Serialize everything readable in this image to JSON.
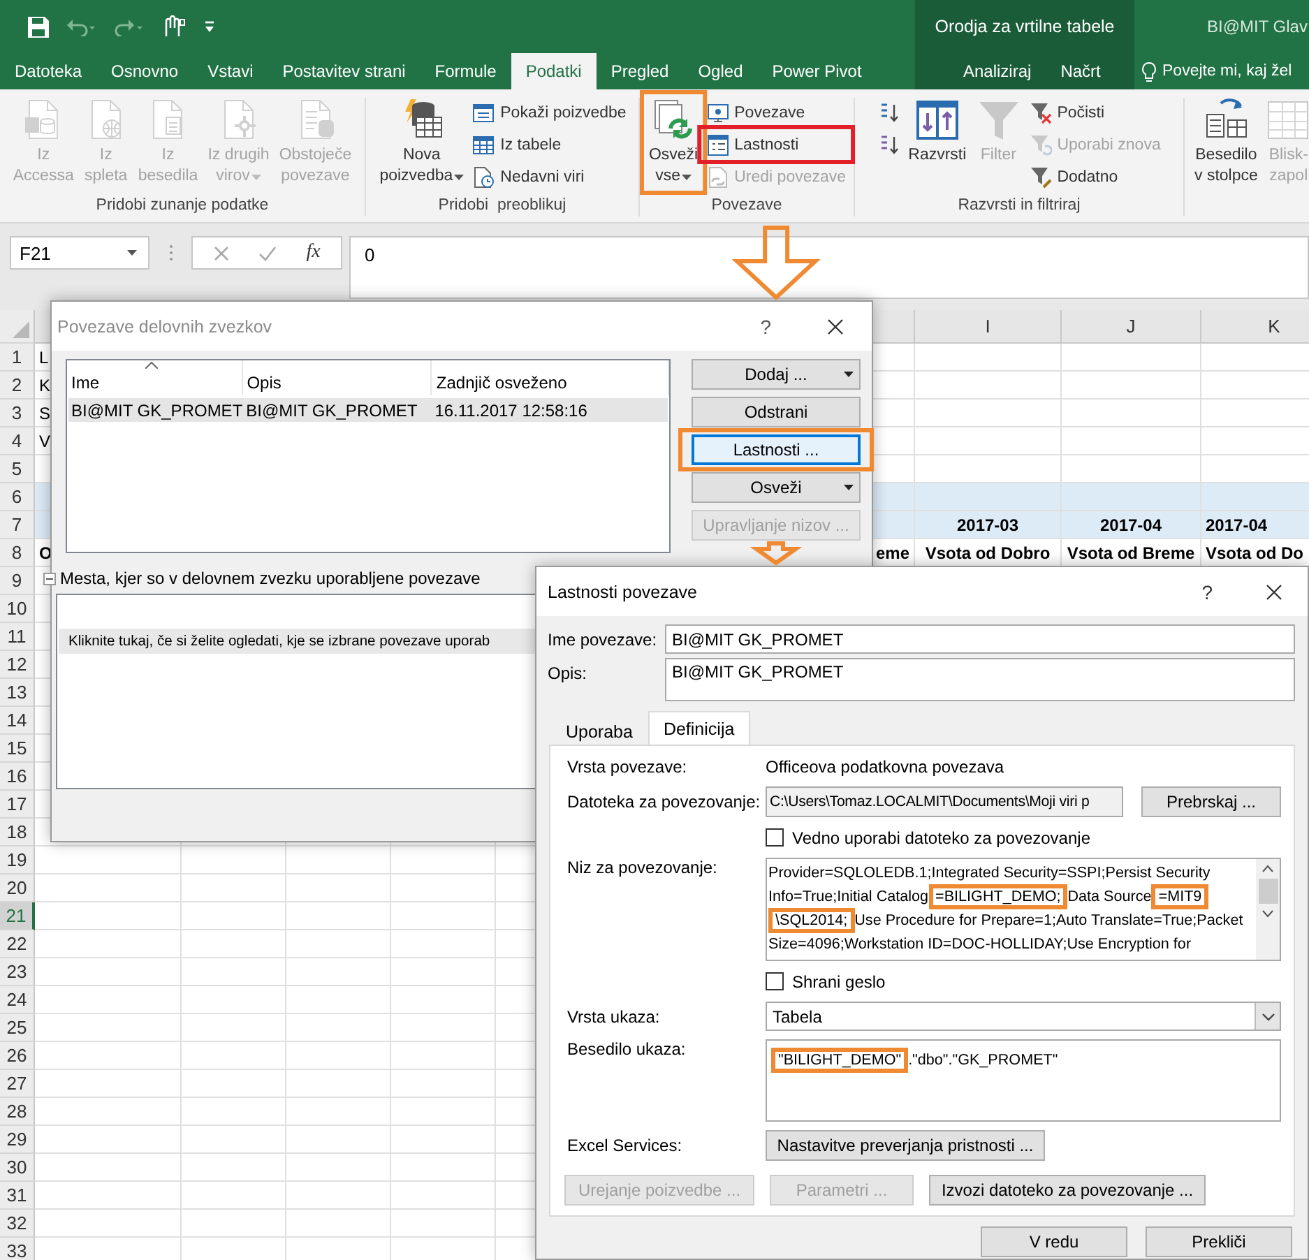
{
  "title_bar": {
    "context_title": "Orodja za vrtilne tabele",
    "document_title": "BI@MIT Glav"
  },
  "ribbon_tabs": [
    {
      "label": "Datoteka",
      "selected": false,
      "kind": "main"
    },
    {
      "label": "Osnovno",
      "selected": false,
      "kind": "main"
    },
    {
      "label": "Vstavi",
      "selected": false,
      "kind": "main"
    },
    {
      "label": "Postavitev strani",
      "selected": false,
      "kind": "main"
    },
    {
      "label": "Formule",
      "selected": false,
      "kind": "main"
    },
    {
      "label": "Podatki",
      "selected": true,
      "kind": "main"
    },
    {
      "label": "Pregled",
      "selected": false,
      "kind": "main"
    },
    {
      "label": "Ogled",
      "selected": false,
      "kind": "main"
    },
    {
      "label": "Power Pivot",
      "selected": false,
      "kind": "main"
    },
    {
      "label": "Analiziraj",
      "selected": false,
      "kind": "context"
    },
    {
      "label": "Načrt",
      "selected": false,
      "kind": "context"
    }
  ],
  "tell_me": "Povejte mi, kaj žel",
  "ribbon_groups": [
    {
      "label": "Pridobi zunanje podatke",
      "controls": [
        {
          "kind": "large",
          "lines": [
            "Iz",
            "Accessa"
          ],
          "disabled": true,
          "dropdown": false
        },
        {
          "kind": "large",
          "lines": [
            "Iz",
            "spleta"
          ],
          "disabled": true,
          "dropdown": false
        },
        {
          "kind": "large",
          "lines": [
            "Iz",
            "besedila"
          ],
          "disabled": true,
          "dropdown": false
        },
        {
          "kind": "large",
          "lines": [
            "Iz drugih",
            "virov"
          ],
          "disabled": true,
          "dropdown": true
        },
        {
          "kind": "large",
          "lines": [
            "Obstoječe",
            "povezave"
          ],
          "disabled": true,
          "dropdown": false
        }
      ]
    },
    {
      "label": "Pridobi  preoblikuj",
      "controls": [
        {
          "kind": "large",
          "lines": [
            "Nova",
            "poizvedba"
          ],
          "disabled": false,
          "dropdown": true
        },
        {
          "kind": "stack",
          "items": [
            {
              "kind": "small",
              "label": "Pokaži poizvedbe",
              "disabled": false
            },
            {
              "kind": "small",
              "label": "Iz tabele",
              "disabled": false
            },
            {
              "kind": "small",
              "label": "Nedavni viri",
              "disabled": false
            }
          ]
        }
      ]
    },
    {
      "label": "Povezave",
      "controls": [
        {
          "kind": "large",
          "lines": [
            "Osveži",
            "vse"
          ],
          "disabled": false,
          "dropdown": true
        },
        {
          "kind": "stack",
          "items": [
            {
              "kind": "small",
              "label": "Povezave",
              "disabled": false
            },
            {
              "kind": "small",
              "label": "Lastnosti",
              "disabled": false
            },
            {
              "kind": "small",
              "label": "Uredi povezave",
              "disabled": true
            }
          ]
        }
      ]
    },
    {
      "label": "Razvrsti in filtriraj",
      "controls": [
        {
          "kind": "stack",
          "items": [
            {
              "kind": "icon",
              "disabled": false
            },
            {
              "kind": "icon",
              "disabled": false
            }
          ]
        },
        {
          "kind": "large",
          "lines": [
            "Razvrsti"
          ],
          "disabled": false,
          "dropdown": false
        },
        {
          "kind": "large",
          "lines": [
            "Filter"
          ],
          "disabled": true,
          "dropdown": false
        },
        {
          "kind": "stack",
          "items": [
            {
              "kind": "small",
              "label": "Počisti",
              "disabled": false
            },
            {
              "kind": "small",
              "label": "Uporabi znova",
              "disabled": true
            },
            {
              "kind": "small",
              "label": "Dodatno",
              "disabled": false
            }
          ]
        }
      ]
    },
    {
      "controls": [
        {
          "kind": "large",
          "lines": [
            "Besedilo",
            "v stolpce"
          ],
          "disabled": false,
          "dropdown": false
        },
        {
          "kind": "large",
          "lines": [
            "Blisk-",
            "zapol"
          ],
          "disabled": true,
          "dropdown": false
        }
      ]
    }
  ],
  "formula_bar": {
    "name_box": "F21",
    "function_label": "fx",
    "value": "0"
  },
  "sheet": {
    "columns": [
      {
        "label": "I"
      },
      {
        "label": "J"
      },
      {
        "label": "K"
      }
    ],
    "rows": [
      {
        "number": "1",
        "selected": false,
        "shaded": false,
        "left_text": "L"
      },
      {
        "number": "2",
        "selected": false,
        "shaded": false,
        "left_text": "K"
      },
      {
        "number": "3",
        "selected": false,
        "shaded": false,
        "left_text": "S"
      },
      {
        "number": "4",
        "selected": false,
        "shaded": false,
        "left_text": "V"
      },
      {
        "number": "5",
        "selected": false,
        "shaded": false
      },
      {
        "number": "6",
        "selected": false,
        "shaded": true
      },
      {
        "number": "7",
        "selected": false,
        "shaded": true,
        "bold": true,
        "values": [
          "2017-03",
          "2017-04",
          "2017-04"
        ]
      },
      {
        "number": "8",
        "selected": false,
        "shaded": false,
        "bold": true,
        "left_text": "O",
        "edge_text": "eme",
        "values": [
          "Vsota od Dobro",
          "Vsota od Breme",
          "Vsota od Do"
        ]
      },
      {
        "number": "9",
        "selected": false,
        "shaded": false
      },
      {
        "number": "10",
        "selected": false,
        "shaded": false
      },
      {
        "number": "11",
        "selected": false,
        "shaded": false
      },
      {
        "number": "12",
        "selected": false,
        "shaded": false
      },
      {
        "number": "13",
        "selected": false,
        "shaded": false
      },
      {
        "number": "14",
        "selected": false,
        "shaded": false
      },
      {
        "number": "15",
        "selected": false,
        "shaded": false
      },
      {
        "number": "16",
        "selected": false,
        "shaded": false
      },
      {
        "number": "17",
        "selected": false,
        "shaded": false
      },
      {
        "number": "18",
        "selected": false,
        "shaded": false
      },
      {
        "number": "19",
        "selected": false,
        "shaded": false
      },
      {
        "number": "20",
        "selected": false,
        "shaded": false
      },
      {
        "number": "21",
        "selected": true,
        "shaded": false
      },
      {
        "number": "22",
        "selected": false,
        "shaded": false
      },
      {
        "number": "23",
        "selected": false,
        "shaded": false
      },
      {
        "number": "24",
        "selected": false,
        "shaded": false
      },
      {
        "number": "25",
        "selected": false,
        "shaded": false
      },
      {
        "number": "26",
        "selected": false,
        "shaded": false
      },
      {
        "number": "27",
        "selected": false,
        "shaded": false
      },
      {
        "number": "28",
        "selected": false,
        "shaded": false
      },
      {
        "number": "29",
        "selected": false,
        "shaded": false
      },
      {
        "number": "30",
        "selected": false,
        "shaded": false
      },
      {
        "number": "31",
        "selected": false,
        "shaded": false
      },
      {
        "number": "32",
        "selected": false,
        "shaded": false
      },
      {
        "number": "33",
        "selected": false,
        "shaded": false
      }
    ]
  },
  "connections_dialog": {
    "title": "Povezave delovnih zvezkov",
    "help": "?",
    "columns": [
      {
        "label": "Ime",
        "sorted": true
      },
      {
        "label": "Opis",
        "sorted": false
      },
      {
        "label": "Zadnjič osveženo",
        "sorted": false
      }
    ],
    "rows": [
      {
        "cells": [
          "BI@MIT GK_PROMET",
          "BI@MIT GK_PROMET",
          "16.11.2017  12:58:16"
        ],
        "selected": true
      }
    ],
    "buttons": [
      {
        "label": "Dodaj ...",
        "dropdown": true,
        "disabled": false,
        "focused": false
      },
      {
        "label": "Odstrani",
        "dropdown": false,
        "disabled": false,
        "focused": false
      },
      {
        "label": "Lastnosti ...",
        "dropdown": false,
        "disabled": false,
        "focused": true
      },
      {
        "label": "Osveži",
        "dropdown": true,
        "disabled": false,
        "focused": false
      },
      {
        "label": "Upravljanje nizov ...",
        "dropdown": false,
        "disabled": true,
        "focused": false
      }
    ],
    "locations": {
      "label": "Mesta, kjer so v delovnem zvezku uporabljene povezave",
      "expanded": true,
      "items": [
        {
          "text": "Kliknite tukaj, če si želite ogledati, kje se izbrane povezave uporab",
          "selected": true
        }
      ]
    }
  },
  "properties_dialog": {
    "title": "Lastnosti povezave",
    "help": "?",
    "fields": [
      {
        "kind": "input",
        "label": "Ime povezave:",
        "value": "BI@MIT GK_PROMET"
      },
      {
        "kind": "textarea",
        "label": "Opis:",
        "value": "BI@MIT GK_PROMET"
      }
    ],
    "tabs": [
      {
        "label": "Uporaba",
        "selected": false
      },
      {
        "label": "Definicija",
        "selected": true
      }
    ],
    "rows": [
      {
        "kind": "text",
        "label": "Vrsta povezave:",
        "value": "Officeova podatkovna povezava"
      },
      {
        "kind": "file",
        "label": "Datoteka za povezovanje:",
        "value": "C:\\Users\\Tomaz.LOCALMIT\\Documents\\Moji viri p",
        "button": "Prebrskaj ..."
      },
      {
        "kind": "checkbox",
        "label": "Vedno uporabi datoteko za povezovanje",
        "checked": false
      },
      {
        "kind": "multiline",
        "label": "Niz za povezovanje:",
        "lines": [
          {
            "segments": [
              {
                "text": "Provider=SQLOLEDB.1;Integrated Security=SSPI;Persist Security",
                "highlight": false
              }
            ]
          },
          {
            "segments": [
              {
                "text": "Info=True;Initial Catalog",
                "highlight": false
              },
              {
                "text": "=BILIGHT_DEMO;",
                "highlight": true
              },
              {
                "text": "Data Source",
                "highlight": false
              },
              {
                "text": "=MIT9",
                "highlight": true
              }
            ]
          },
          {
            "segments": [
              {
                "text": "\\SQL2014;",
                "highlight": true
              },
              {
                "text": "Use Procedure for Prepare=1;Auto Translate=True;Packet",
                "highlight": false
              }
            ]
          },
          {
            "segments": [
              {
                "text": "Size=4096;Workstation ID=DOC-HOLLIDAY;Use Encryption for",
                "highlight": false
              }
            ]
          }
        ]
      },
      {
        "kind": "checkbox",
        "label": "Shrani geslo",
        "checked": false
      },
      {
        "kind": "select",
        "label": "Vrsta ukaza:",
        "value": "Tabela"
      },
      {
        "kind": "textarea",
        "label": "Besedilo ukaza:",
        "lines": [
          {
            "segments": [
              {
                "text": "\"BILIGHT_DEMO\"",
                "highlight": true
              },
              {
                "text": ".\"dbo\".\"GK_PROMET\"",
                "highlight": false
              }
            ]
          }
        ]
      },
      {
        "kind": "button",
        "label": "Excel Services:",
        "button": "Nastavitve preverjanja pristnosti ..."
      }
    ],
    "actions": [
      {
        "label": "Urejanje poizvedbe ...",
        "disabled": true
      },
      {
        "label": "Parametri ...",
        "disabled": true
      },
      {
        "label": "Izvozi datoteko za povezovanje ...",
        "disabled": false
      }
    ],
    "footer_buttons": [
      {
        "label": "V redu",
        "disabled": false
      },
      {
        "label": "Prekliči",
        "disabled": false
      }
    ]
  },
  "annotations": [
    {
      "kind": "box",
      "color": "#f08a32"
    },
    {
      "kind": "box",
      "color": "#e3202a"
    },
    {
      "kind": "arrow",
      "color": "#f08a32"
    },
    {
      "kind": "box",
      "color": "#f08a32"
    },
    {
      "kind": "arrow",
      "color": "#f08a32"
    }
  ]
}
